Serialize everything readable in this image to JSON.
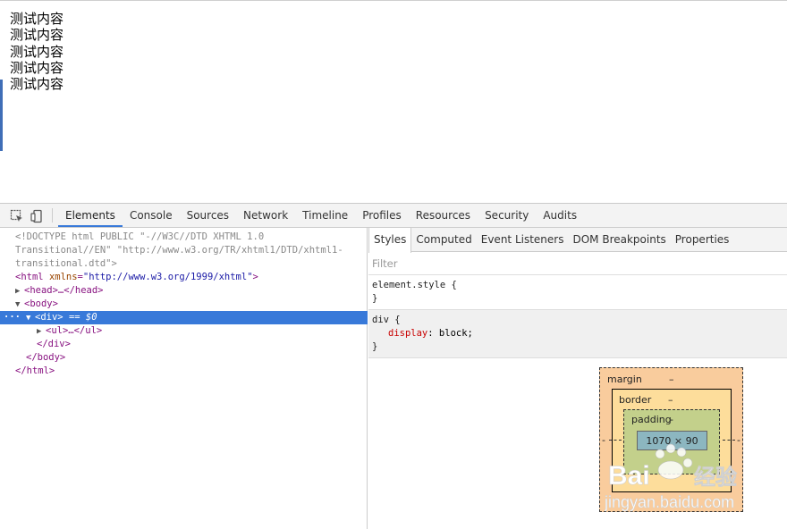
{
  "page": {
    "lines": [
      "测试内容",
      "测试内容",
      "测试内容",
      "测试内容",
      "测试内容"
    ]
  },
  "toolbar": {
    "tabs": [
      "Elements",
      "Console",
      "Sources",
      "Network",
      "Timeline",
      "Profiles",
      "Resources",
      "Security",
      "Audits"
    ],
    "active_tab": "Elements"
  },
  "dom": {
    "doctype_1": "<!DOCTYPE html PUBLIC \"-//W3C//DTD XHTML 1.0",
    "doctype_2": "Transitional//EN\" \"http://www.w3.org/TR/xhtml1/DTD/xhtml1-",
    "doctype_3": "transitional.dtd\">",
    "html_open": "<html",
    "html_attr": "xmlns",
    "html_val": "\"http://www.w3.org/1999/xhtml\"",
    "head": "<head>…</head>",
    "body_open": "<body>",
    "div_open": "<div>",
    "div_marker": "== $0",
    "ul": "<ul>…</ul>",
    "div_close": "</div>",
    "body_close": "</body>",
    "html_close": "</html>"
  },
  "sidebar": {
    "tabs": [
      "Styles",
      "Computed",
      "Event Listeners",
      "DOM Breakpoints",
      "Properties"
    ],
    "active_tab": "Styles",
    "filter_placeholder": "Filter",
    "element_style_selector": "element.style {",
    "close_brace": "}",
    "ua_rule_selector": "div {",
    "ua_rule_property": "display",
    "ua_rule_value": "block;"
  },
  "boxmodel": {
    "margin_label": "margin",
    "margin_value": "–",
    "border_label": "border",
    "border_value": "–",
    "padding_label": "padding",
    "padding_value": "-",
    "content_size": "1070 × 90",
    "side_dash": "-"
  },
  "colors": {
    "selection": "#3879d9",
    "margin": "#f9cc9d",
    "border": "#fddd9b",
    "padding": "#c3d08b",
    "content": "#8cb6c0"
  }
}
